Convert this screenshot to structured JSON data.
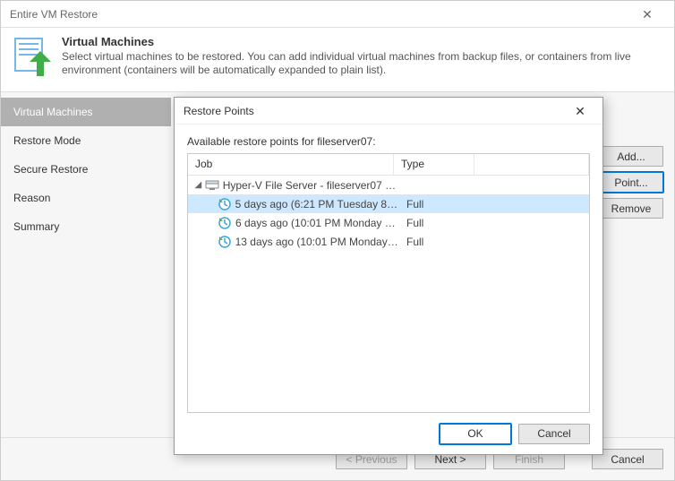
{
  "main": {
    "title": "Entire VM Restore",
    "header_title": "Virtual Machines",
    "header_desc": "Select virtual machines to be restored. You  can add individual virtual machines from backup files, or containers from live environment (containers will be automatically expanded to plain list)."
  },
  "sidebar": {
    "items": [
      {
        "label": "Virtual Machines",
        "active": true
      },
      {
        "label": "Restore Mode"
      },
      {
        "label": "Secure Restore"
      },
      {
        "label": "Reason"
      },
      {
        "label": "Summary"
      }
    ]
  },
  "right_buttons": {
    "add": "Add...",
    "point": "Point...",
    "remove": "Remove"
  },
  "footer": {
    "prev": "< Previous",
    "next": "Next >",
    "finish": "Finish",
    "cancel": "Cancel"
  },
  "modal": {
    "title": "Restore Points",
    "subtitle": "Available restore points for fileserver07:",
    "columns": {
      "job": "Job",
      "type": "Type"
    },
    "job_row": "Hyper-V File Server - fileserver07 (Defa...",
    "points": [
      {
        "label": "5 days ago (6:21 PM Tuesday 8/8/20...",
        "type": "Full",
        "selected": true
      },
      {
        "label": "6 days ago (10:01 PM Monday 8/7/2...",
        "type": "Full"
      },
      {
        "label": "13 days ago (10:01 PM Monday 7/31...",
        "type": "Full"
      }
    ],
    "ok": "OK",
    "cancel": "Cancel"
  }
}
